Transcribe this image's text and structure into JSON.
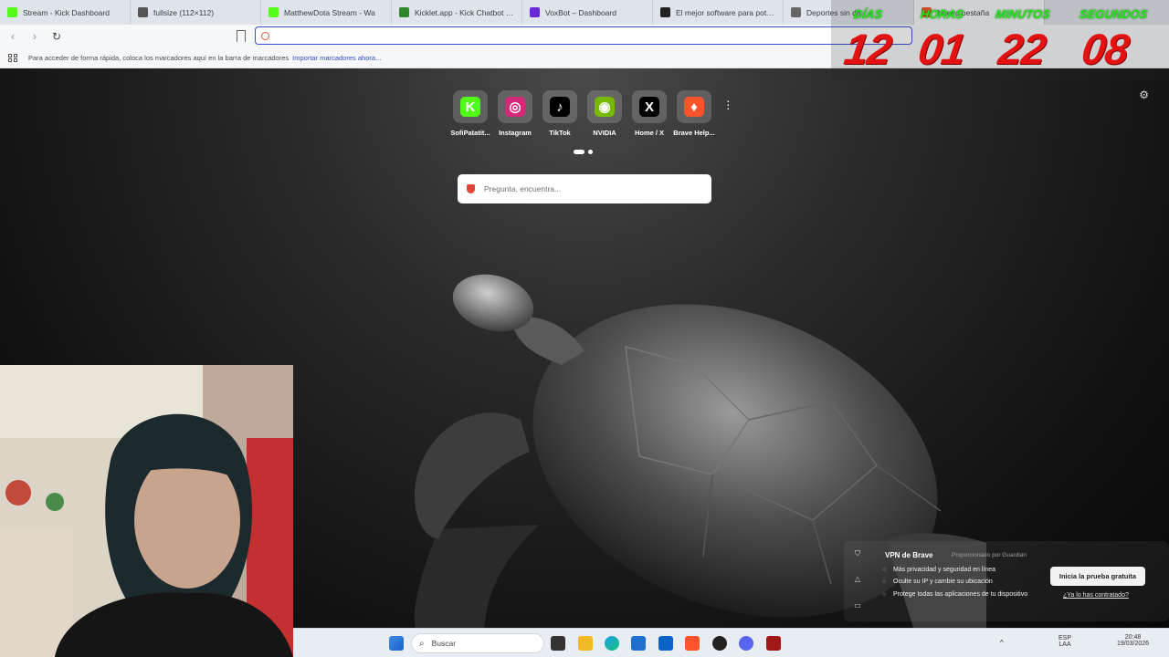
{
  "tabs": [
    {
      "title": "Stream - Kick Dashboard",
      "icon": "kick-icon",
      "color": "#53fc18",
      "active": false
    },
    {
      "title": "fullsize (112×112)",
      "icon": "globe-icon",
      "color": "#555555",
      "active": false
    },
    {
      "title": "MatthewDota Stream - Wa",
      "icon": "kick-icon",
      "color": "#53fc18",
      "active": false
    },
    {
      "title": "Kicklet.app - Kick Chatbot and",
      "icon": "kicklet-icon",
      "color": "#2c8a2c",
      "active": false
    },
    {
      "title": "VoxBot – Dashboard",
      "icon": "voxbot-icon",
      "color": "#6a2bd4",
      "active": false
    },
    {
      "title": "El mejor software para potenci",
      "icon": "obs-icon",
      "color": "#222222",
      "active": false
    },
    {
      "title": "Deportes sin dif",
      "icon": "globe-icon",
      "color": "#666666",
      "active": false
    },
    {
      "title": "Nueva pestaña",
      "icon": "brave-icon",
      "color": "#fb542b",
      "active": true
    }
  ],
  "bookmarks_bar": {
    "text": "Para acceder de forma rápida, coloca los marcadores aquí en la barra de marcadores",
    "link": "Importar marcadores ahora..."
  },
  "counter": {
    "labels": [
      "DÍAS",
      "HORAS",
      "MINUTOS",
      "SEGUNDOS"
    ],
    "values": [
      "12",
      "01",
      "22",
      "08"
    ]
  },
  "top_sites": [
    {
      "name": "SofiPatatit...",
      "icon": "kick-icon",
      "color": "#53fc18",
      "glyph": "K"
    },
    {
      "name": "Instagram",
      "icon": "instagram-icon",
      "color": "#d6287a",
      "glyph": "◎"
    },
    {
      "name": "TikTok",
      "icon": "tiktok-icon",
      "color": "#000000",
      "glyph": "♪"
    },
    {
      "name": "NVIDIA",
      "icon": "nvidia-icon",
      "color": "#76b900",
      "glyph": "◉"
    },
    {
      "name": "Home / X",
      "icon": "x-icon",
      "color": "#000000",
      "glyph": "X"
    },
    {
      "name": "Brave Help...",
      "icon": "brave-icon",
      "color": "#fb542b",
      "glyph": "♦"
    }
  ],
  "search": {
    "placeholder": "Pregunta, encuentra..."
  },
  "vpn": {
    "title": "VPN de Brave",
    "powered_by": "Proporcionado por  Guardian",
    "features": [
      "Más privacidad y seguridad en línea",
      "Oculte su IP y cambie su ubicación",
      "Protege todas las aplicaciones de tu dispositivo"
    ],
    "trial_button": "Inicia la prueba gratuita",
    "contracted_link": "¿Ya lo has contratado?"
  },
  "taskbar": {
    "search_placeholder": "Buscar",
    "lang": "ESP",
    "lang_sub": "LAA",
    "time": "20:48",
    "date": "19/03/2026"
  }
}
